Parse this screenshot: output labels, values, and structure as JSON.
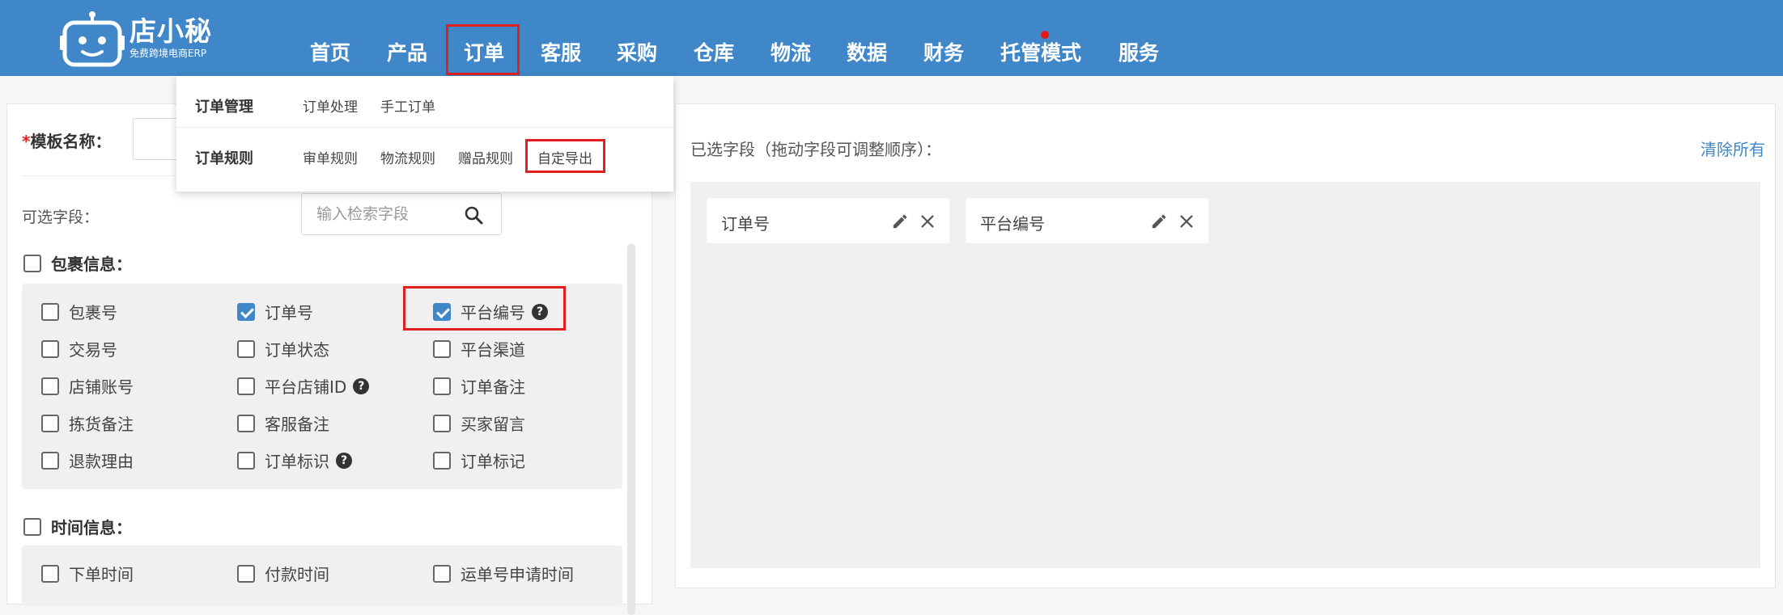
{
  "logo": {
    "name": "店小秘",
    "tagline": "免费跨境电商ERP"
  },
  "nav": {
    "items": [
      "首页",
      "产品",
      "订单",
      "客服",
      "采购",
      "仓库",
      "物流",
      "数据",
      "财务",
      "托管模式",
      "服务"
    ]
  },
  "order_menu": {
    "groups": [
      {
        "title": "订单管理",
        "links": [
          "订单处理",
          "手工订单"
        ]
      },
      {
        "title": "订单规则",
        "links": [
          "审单规则",
          "物流规则",
          "赠品规则",
          "自定导出"
        ]
      }
    ]
  },
  "form": {
    "template_label": "模板名称：",
    "required_mark": "*",
    "template_value": ""
  },
  "available": {
    "label": "可选字段：",
    "search_placeholder": "输入检索字段",
    "groups": [
      {
        "title": "包裹信息：",
        "checked": false,
        "fields": [
          {
            "label": "包裹号",
            "checked": false
          },
          {
            "label": "订单号",
            "checked": true
          },
          {
            "label": "平台编号",
            "checked": true,
            "help": "?"
          },
          {
            "label": "交易号",
            "checked": false
          },
          {
            "label": "订单状态",
            "checked": false
          },
          {
            "label": "平台渠道",
            "checked": false
          },
          {
            "label": "店铺账号",
            "checked": false
          },
          {
            "label": "平台店铺ID",
            "checked": false,
            "help": "?"
          },
          {
            "label": "订单备注",
            "checked": false
          },
          {
            "label": "拣货备注",
            "checked": false
          },
          {
            "label": "客服备注",
            "checked": false
          },
          {
            "label": "买家留言",
            "checked": false
          },
          {
            "label": "退款理由",
            "checked": false
          },
          {
            "label": "订单标识",
            "checked": false,
            "help": "?"
          },
          {
            "label": "订单标记",
            "checked": false
          }
        ]
      },
      {
        "title": "时间信息：",
        "checked": false,
        "fields": [
          {
            "label": "下单时间",
            "checked": false
          },
          {
            "label": "付款时间",
            "checked": false
          },
          {
            "label": "运单号申请时间",
            "checked": false
          }
        ]
      }
    ]
  },
  "selected": {
    "label": "已选字段（拖动字段可调整顺序）：",
    "clear_all": "清除所有",
    "chips": [
      "订单号",
      "平台编号"
    ]
  },
  "colors": {
    "brand": "#3f87c9",
    "highlight": "#e02020",
    "checked": "#3f87c9"
  }
}
